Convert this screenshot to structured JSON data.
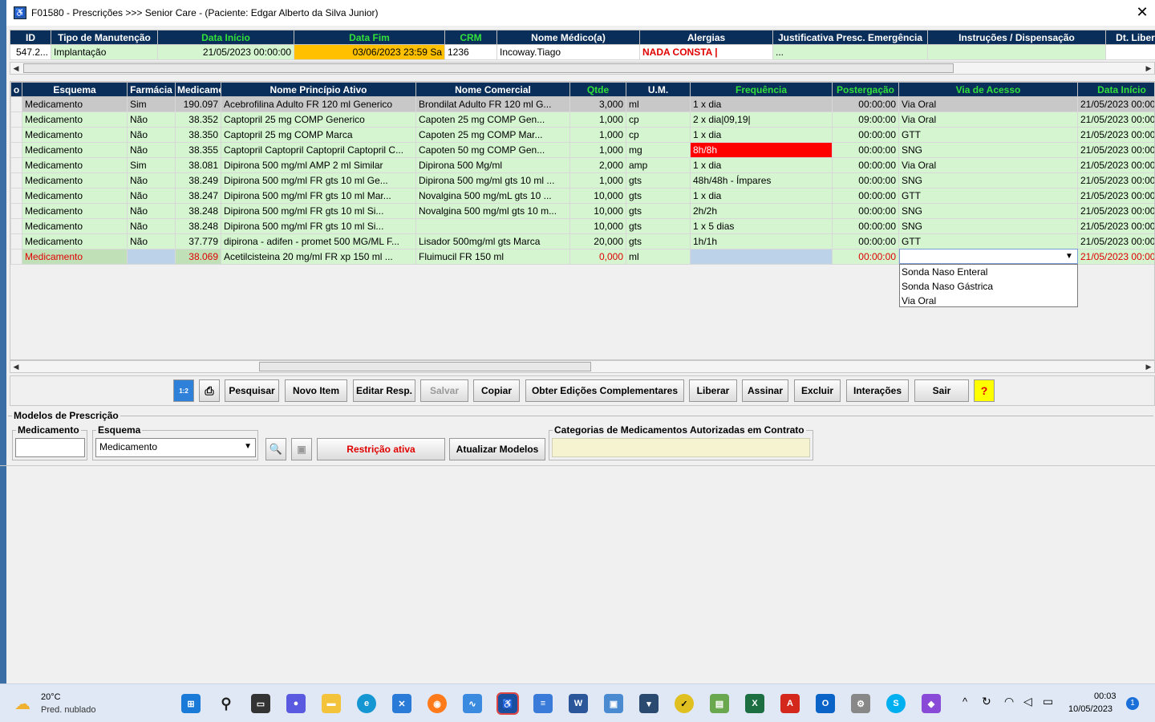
{
  "window": {
    "title": "F01580 - Prescrições >>> Senior Care - (Paciente: Edgar Alberto da Silva Junior)",
    "close": "✕"
  },
  "top_table": {
    "headers": [
      "ID",
      "Tipo de Manutenção",
      "Data Início",
      "Data Fim",
      "CRM",
      "Nome Médico(a)",
      "Alergias",
      "Justificativa Presc. Emergência",
      "Instruções / Dispensação",
      "Dt. Liber"
    ],
    "row": [
      "547.2...",
      "Implantação",
      "21/05/2023 00:00:00",
      "03/06/2023 23:59 Sa",
      "1236",
      "Incoway.Tiago",
      "NADA CONSTA |",
      "...",
      "",
      ""
    ]
  },
  "main_table": {
    "headers": [
      "o",
      "Esquema",
      "Farmácia",
      "Medicame",
      "Nome Princípio Ativo",
      "Nome Comercial",
      "Qtde",
      "U.M.",
      "Frequência",
      "Postergação",
      "Via de Acesso",
      "Data Início"
    ],
    "rows": [
      [
        "",
        "Medicamento",
        "Sim",
        "190.097",
        "Acebrofilina   Adulto  FR  120 ml   Generico",
        "Brondilat  Adulto  FR  120 ml   G...",
        "3,000",
        "ml",
        "1 x dia",
        "00:00:00",
        "Via Oral",
        "21/05/2023 00:00"
      ],
      [
        "",
        "Medicamento",
        "Não",
        "38.352",
        "Captopril   25 mg  COMP     Generico",
        "Capoten     25 mg  COMP     Gen...",
        "1,000",
        "cp",
        "2 x dia|09,19|",
        "09:00:00",
        "Via Oral",
        "21/05/2023 00:00"
      ],
      [
        "",
        "Medicamento",
        "Não",
        "38.350",
        "Captopril   25 mg  COMP     Marca",
        "Capoten     25 mg  COMP     Mar...",
        "1,000",
        "cp",
        "1 x dia",
        "00:00:00",
        "GTT",
        "21/05/2023 00:00"
      ],
      [
        "",
        "Medicamento",
        "Não",
        "38.355",
        "Captopril  Captopril  Captopril Captopril C...",
        "Capoten     50 mg  COMP     Gen...",
        "1,000",
        "mg",
        "8h/8h",
        "00:00:00",
        "SNG",
        "21/05/2023 00:00"
      ],
      [
        "",
        "Medicamento",
        "Sim",
        "38.081",
        "Dipirona    500 mg/ml  AMP  2 ml   Similar",
        "Dipirona  500 Mg/ml",
        "2,000",
        "amp",
        "1 x dia",
        "00:00:00",
        "Via Oral",
        "21/05/2023 00:00"
      ],
      [
        "",
        "Medicamento",
        "Não",
        "38.249",
        "Dipirona    500 mg/ml  FR  gts 10 ml   Ge...",
        "Dipirona 500 mg/ml   gts 10 ml ...",
        "1,000",
        "gts",
        "48h/48h - Ímpares",
        "00:00:00",
        "SNG",
        "21/05/2023 00:00"
      ],
      [
        "",
        "Medicamento",
        "Não",
        "38.247",
        "Dipirona    500 mg/ml  FR  gts 10 ml   Mar...",
        "Novalgina 500 mg/mL   gts 10 ...",
        "10,000",
        "gts",
        "1 x dia",
        "00:00:00",
        "GTT",
        "21/05/2023 00:00"
      ],
      [
        "",
        "Medicamento",
        "Não",
        "38.248",
        "Dipirona    500 mg/ml  FR  gts 10 ml   Si...",
        "Novalgina 500 mg/ml   gts 10 m...",
        "10,000",
        "gts",
        "2h/2h",
        "00:00:00",
        "SNG",
        "21/05/2023 00:00"
      ],
      [
        "",
        "Medicamento",
        "Não",
        "38.248",
        "Dipirona    500 mg/ml  FR  gts 10 ml   Si...",
        "",
        "10,000",
        "gts",
        "1 x 5 dias",
        "00:00:00",
        "SNG",
        "21/05/2023 00:00"
      ],
      [
        "",
        "Medicamento",
        "Não",
        "37.779",
        "dipirona -  adifen - promet    500 MG/ML  F...",
        "Lisador 500mg/ml  gts Marca",
        "20,000",
        "gts",
        "1h/1h",
        "00:00:00",
        "GTT",
        "21/05/2023 00:00"
      ],
      [
        "",
        "Medicamento",
        "",
        "38.069",
        "Acetilcisteina    20 mg/ml  FR  xp 150 ml   ...",
        "Fluimucil   FR  150 ml",
        "0,000",
        "ml",
        "",
        "00:00:00",
        "",
        "21/05/2023 00:00"
      ]
    ]
  },
  "dropdown_options": [
    "Sonda Naso Enteral",
    "Sonda Naso Gástrica",
    "Via Oral"
  ],
  "toolbar": {
    "pesquisar": "Pesquisar",
    "novo_item": "Novo Item",
    "editar": "Editar Resp.",
    "salvar": "Salvar",
    "copiar": "Copiar",
    "obter": "Obter Edições Complementares",
    "liberar": "Liberar",
    "assinar": "Assinar",
    "excluir": "Excluir",
    "interacoes": "Interações",
    "sair": "Sair",
    "help": "?"
  },
  "modelos": {
    "title": "Modelos de Prescrição",
    "medicamento_label": "Medicamento",
    "medicamento_value": "",
    "esquema_label": "Esquema",
    "esquema_value": "Medicamento",
    "restricao": "Restrição ativa",
    "atualizar": "Atualizar Modelos",
    "categorias_label": "Categorias de Medicamentos Autorizadas em Contrato"
  },
  "taskbar": {
    "temp": "20°C",
    "weather": "Pred. nublado",
    "time": "00:03",
    "date": "10/05/2023",
    "badge": "1"
  },
  "colors": {
    "header": "#0a2e5a",
    "green_header": "#32e03a",
    "row_green": "#d4f5d0",
    "highlight_orange": "#ffc000",
    "alert_red": "#ff0000",
    "help_yellow": "#ffff00"
  }
}
